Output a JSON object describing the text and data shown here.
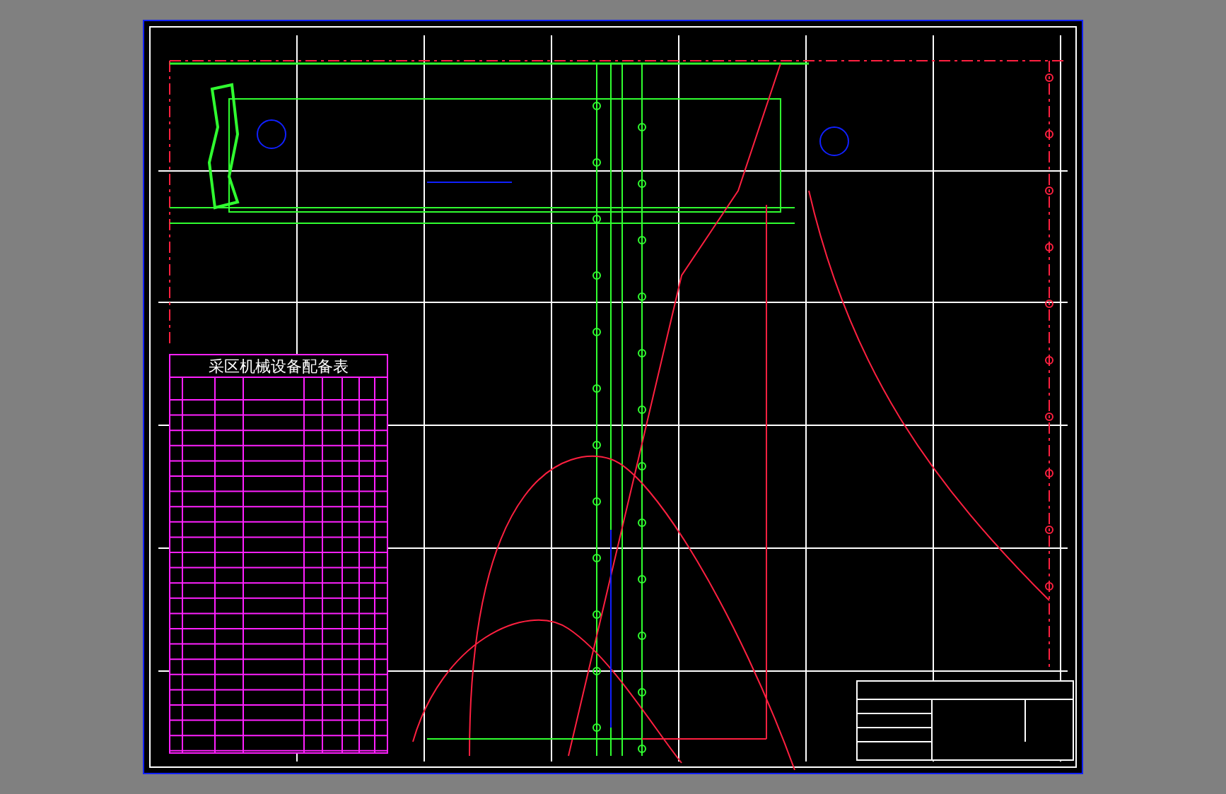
{
  "drawing": {
    "equipment_table": {
      "title": "采区机械设备配备表"
    }
  }
}
